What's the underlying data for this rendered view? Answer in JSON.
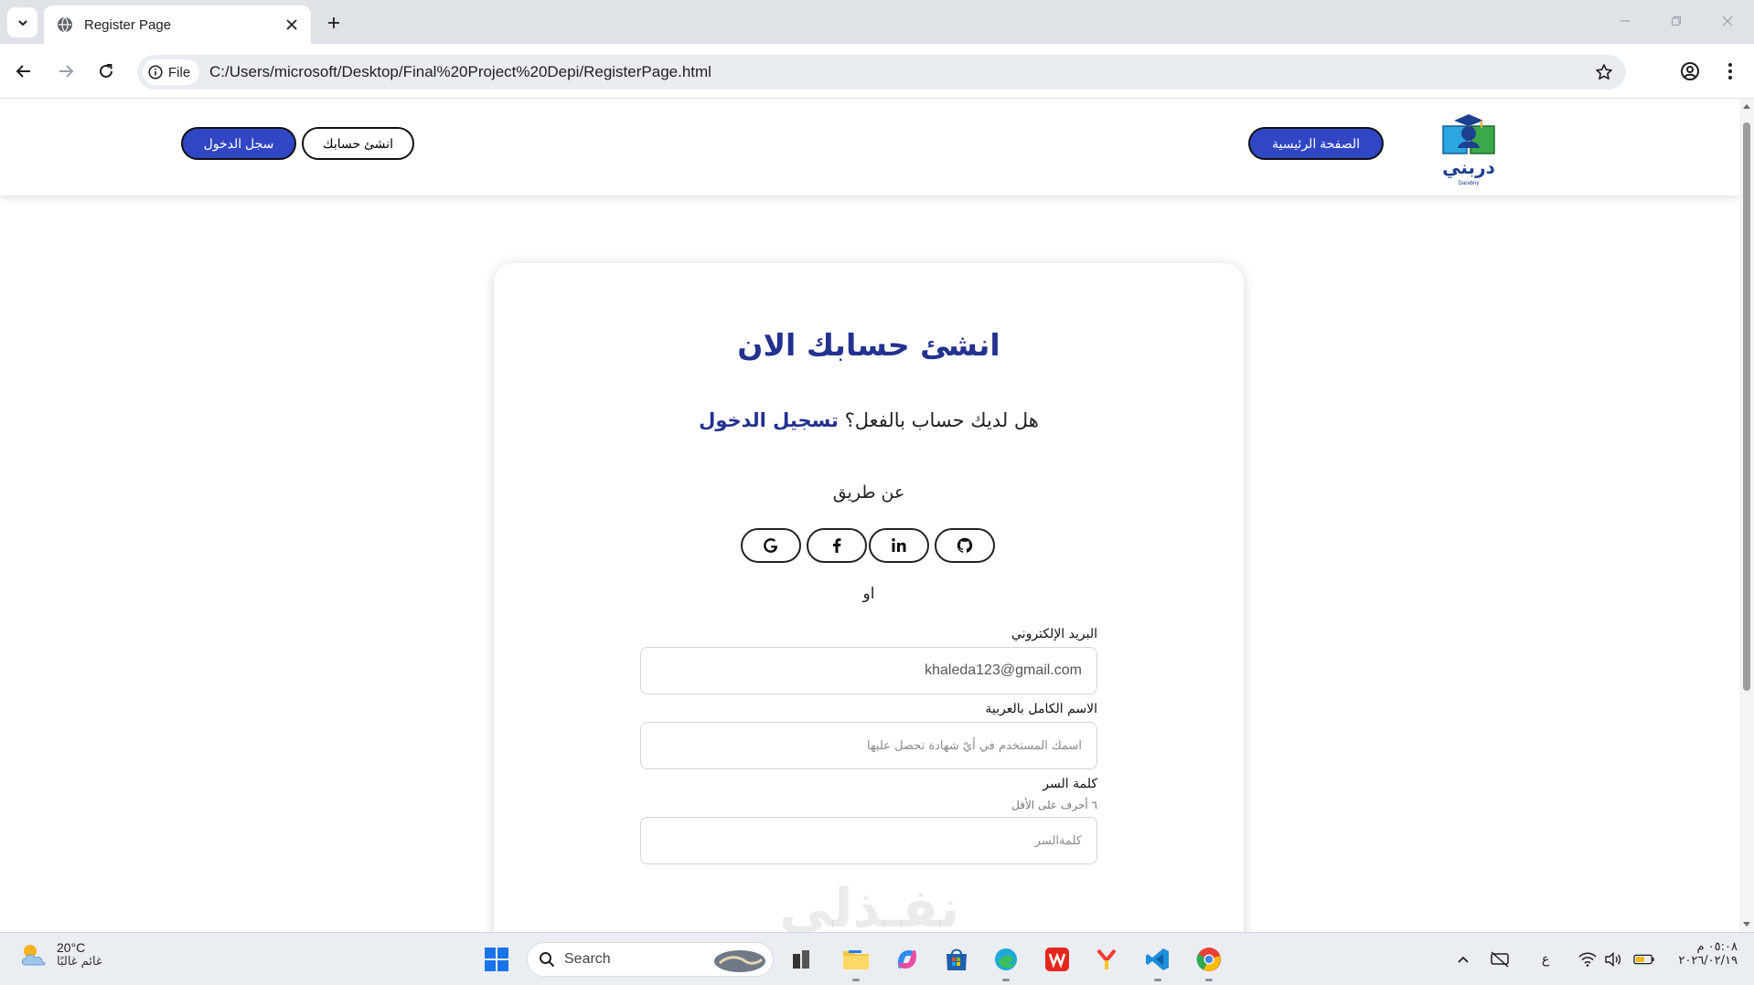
{
  "browser": {
    "tab_title": "Register Page",
    "chip_label": "File",
    "url": "C:/Users/microsoft/Desktop/Final%20Project%20Depi/RegisterPage.html",
    "icons": [
      "tab-search-chevron",
      "globe",
      "close",
      "plus",
      "minimize",
      "restore",
      "close",
      "back-arrow",
      "forward-arrow",
      "reload",
      "info",
      "star",
      "profile",
      "kebab-menu"
    ]
  },
  "site_header": {
    "login_button": "سجل الدخول",
    "create_account_button": "انشئ حسابك",
    "home_button": "الصفحة الرئيسية",
    "logo_text": "دربني",
    "logo_subtext": "Darabny"
  },
  "register_card": {
    "title": "انشئ حسابك الان",
    "subtitle_prefix": "هل لديك حساب بالفعل؟",
    "login_link": "تسجيل الدخول",
    "via_label": "عن طريق",
    "social_buttons": [
      "google",
      "facebook",
      "linkedin",
      "github"
    ],
    "or_label": "او",
    "email_label": "البريد الإلكتروني",
    "email_value": "khaleda123@gmail.com",
    "fullname_label": "الاسم الكامل بالعربية",
    "fullname_placeholder": "اسمك المستخدم في أيّ شهادة تحصل عليها",
    "password_label": "كلمة السر",
    "password_hint": "٦ أحرف على الأقل",
    "password_placeholder": "كلمةالسر"
  },
  "watermark": "نفـذلي",
  "taskbar": {
    "temperature": "20°C",
    "condition": "غائم غالبًا",
    "search_label": "Search",
    "apps": [
      "windows-start",
      "search",
      "game-widget",
      "task-view",
      "file-explorer",
      "copilot",
      "store",
      "edge",
      "wps-office",
      "yandex",
      "vscode",
      "chrome"
    ],
    "tray_icons": [
      "chevron-up",
      "location-off",
      "language",
      "wifi",
      "volume",
      "battery"
    ],
    "language_indicator": "ع",
    "time": "٠٥:٠٨ م",
    "date": "٢٠٢٦/٠٢/١٩"
  },
  "colors": {
    "brand_blue": "#3046c5",
    "title_blue": "#23318f",
    "chrome_bg": "#dfe3e8"
  }
}
